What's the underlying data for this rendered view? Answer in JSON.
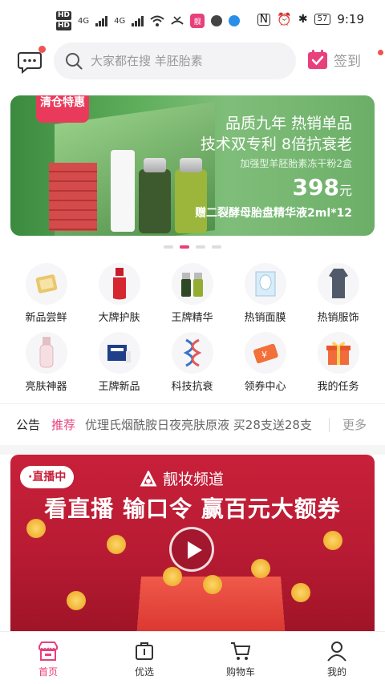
{
  "status_bar": {
    "time": "9:19",
    "battery": "57",
    "hd_top": "HD",
    "hd_bottom": "HD",
    "net1": "4G",
    "net2": "4G"
  },
  "header": {
    "search_placeholder": "大家都在搜 羊胚胎素",
    "checkin_label": "签到"
  },
  "banner": {
    "tag": "清仓特惠",
    "headline_1": "品质九年 热销单品",
    "headline_2": "技术双专利 8倍抗衰老",
    "product": "加强型羊胚胎素冻干粉2盒",
    "price": "398",
    "price_unit": "元",
    "gift": "赠二裂酵母胎盘精华液2ml*12",
    "page_index": 2,
    "page_count": 4
  },
  "categories": [
    {
      "label": "新品尝鲜",
      "icon": "gold-mask-icon"
    },
    {
      "label": "大牌护肤",
      "icon": "red-serum-icon"
    },
    {
      "label": "王牌精华",
      "icon": "ampoule-icon"
    },
    {
      "label": "热销面膜",
      "icon": "face-mask-icon"
    },
    {
      "label": "热销服饰",
      "icon": "dress-icon"
    },
    {
      "label": "亮肤神器",
      "icon": "lotion-bottle-icon"
    },
    {
      "label": "王牌新品",
      "icon": "new-product-box-icon"
    },
    {
      "label": "科技抗衰",
      "icon": "dna-icon"
    },
    {
      "label": "领券中心",
      "icon": "coupon-icon"
    },
    {
      "label": "我的任务",
      "icon": "gift-box-icon"
    }
  ],
  "notice": {
    "label": "公告",
    "tag": "推荐",
    "text": "优理氏烟酰胺日夜亮肤原液 买28支送28支",
    "more": "更多"
  },
  "live": {
    "badge": "·直播中",
    "brand": "靓妆频道",
    "title": "看直播 输口令 赢百元大额券"
  },
  "tabbar": [
    {
      "label": "首页",
      "active": true
    },
    {
      "label": "优选",
      "active": false
    },
    {
      "label": "购物车",
      "active": false
    },
    {
      "label": "我的",
      "active": false
    }
  ],
  "colors": {
    "accent": "#e8407c",
    "live_red": "#c8203a",
    "banner_green": "#5fae5c"
  }
}
